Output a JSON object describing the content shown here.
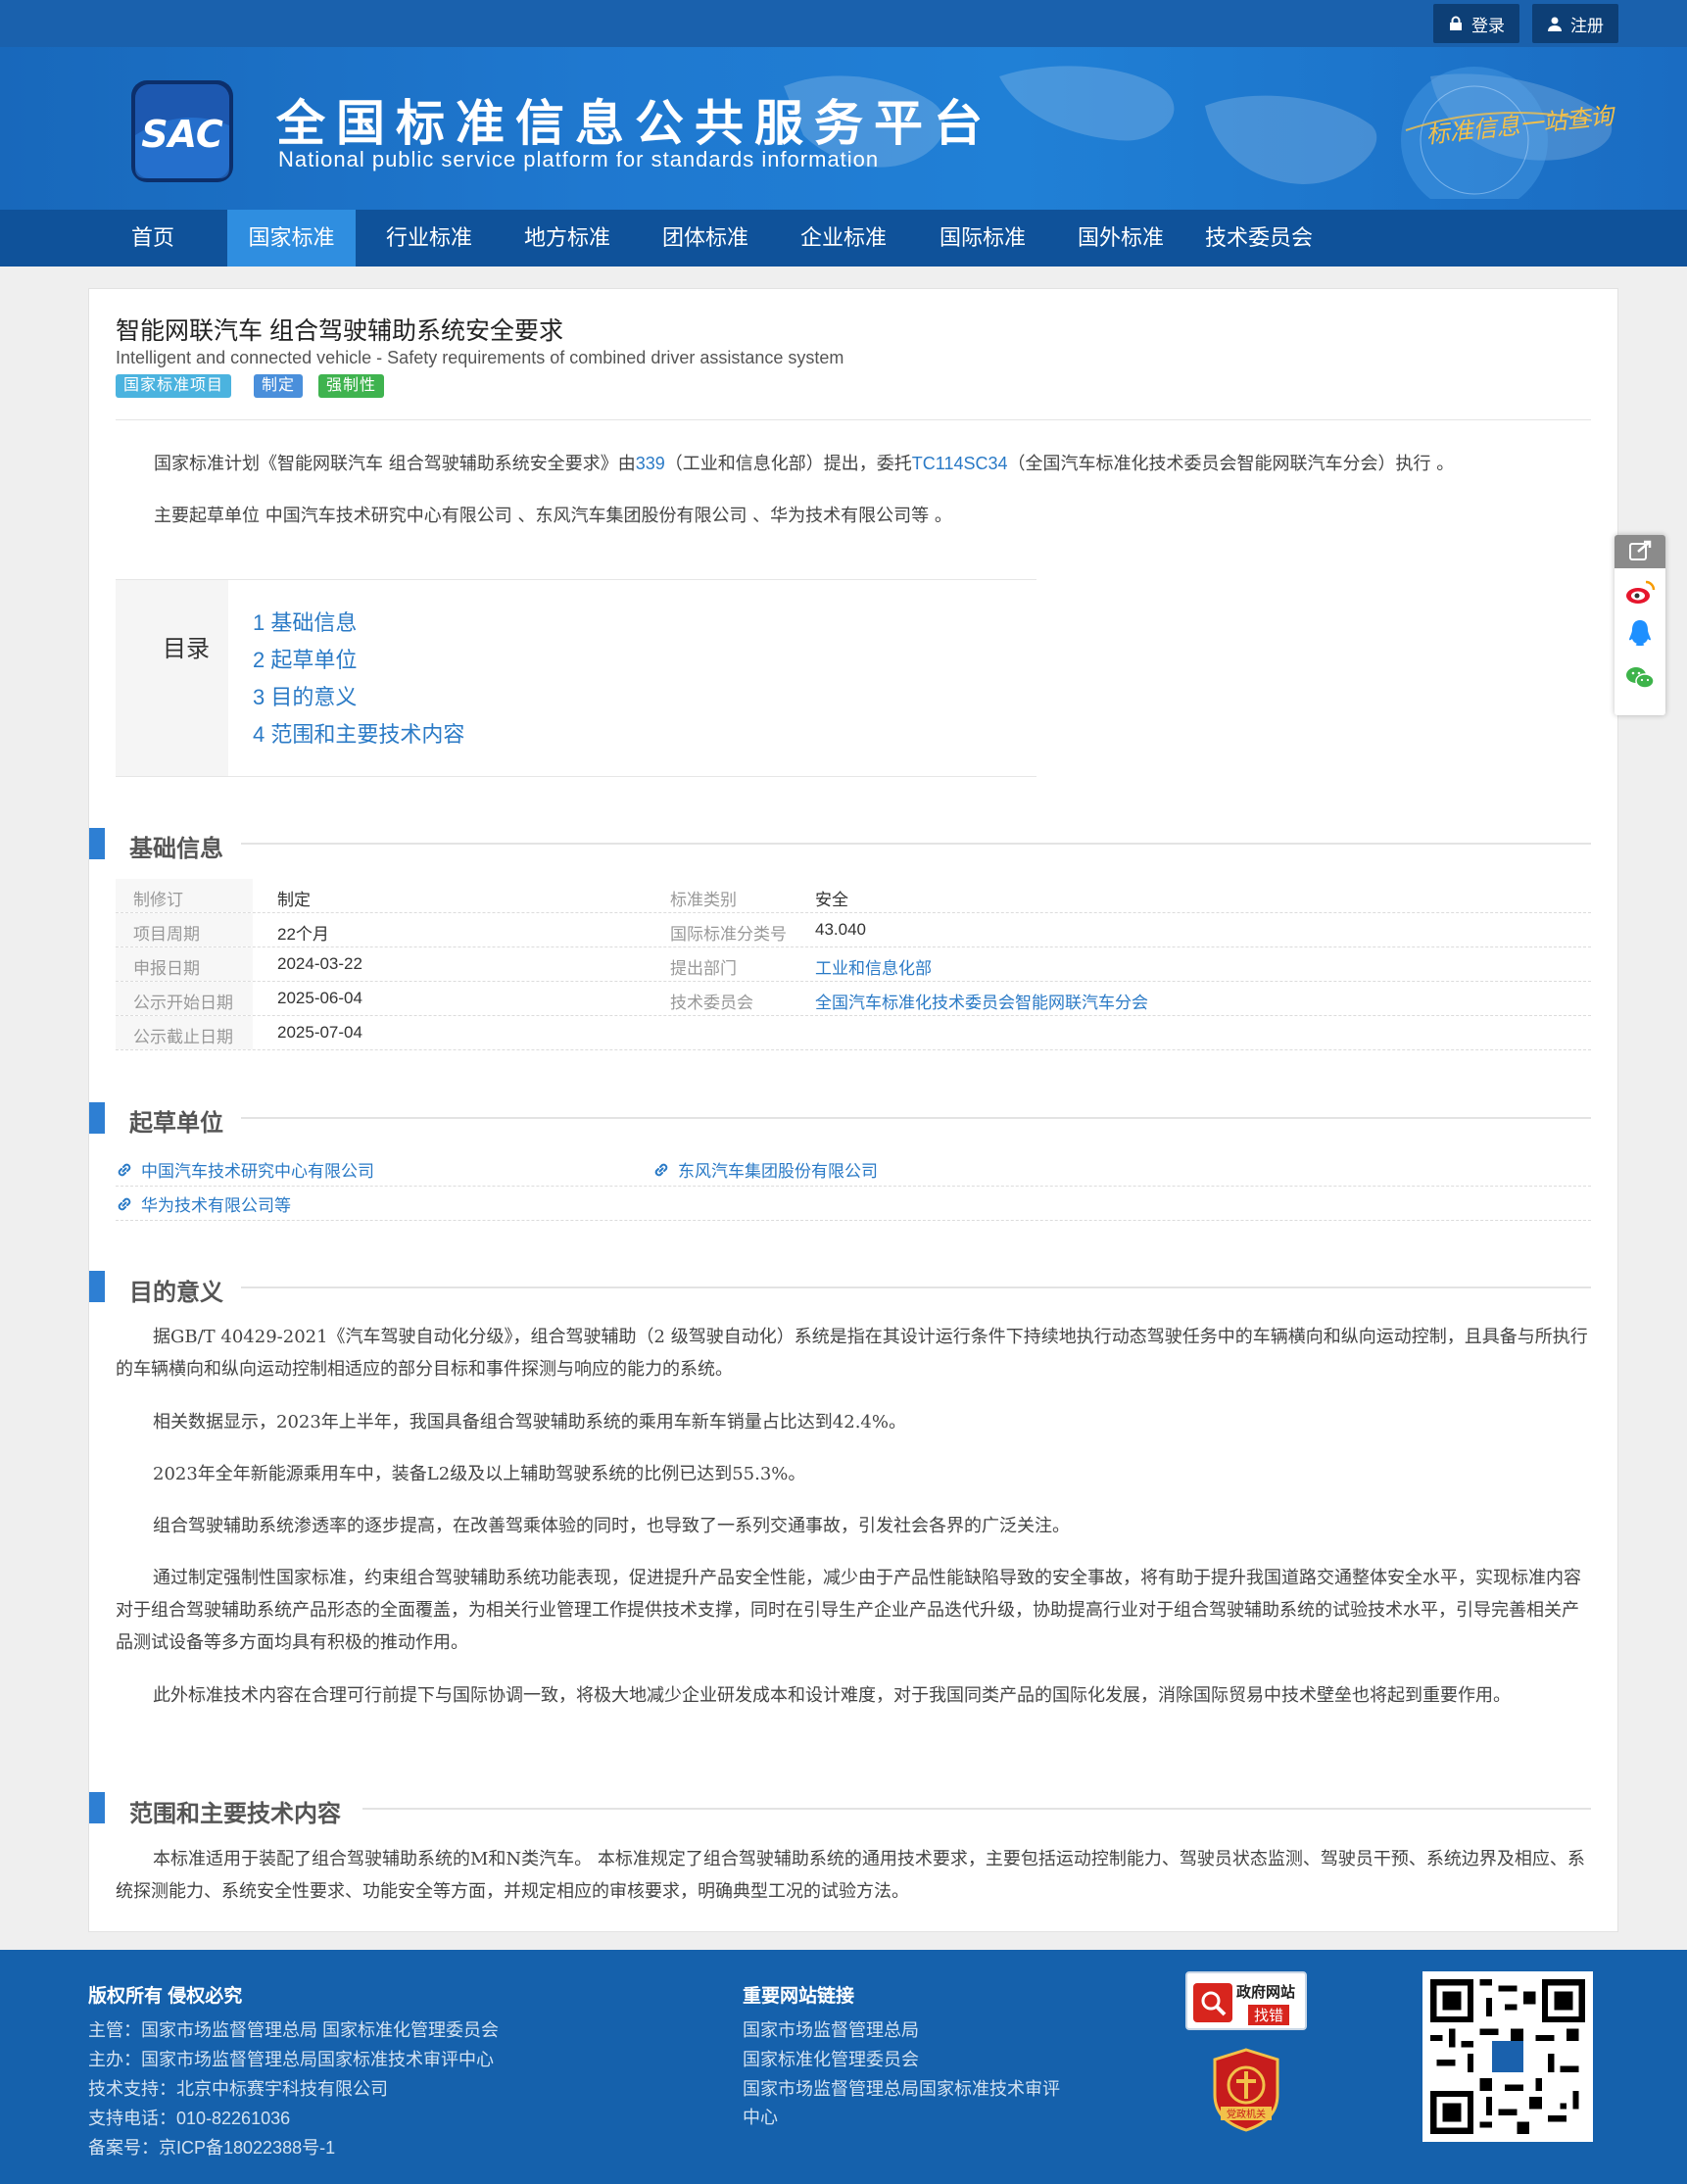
{
  "topbar": {
    "login": "登录",
    "register": "注册"
  },
  "brand": {
    "logo_text": "SAC",
    "name_cn": "全国标准信息公共服务平台",
    "name_en": "National public service platform  for standards information",
    "slogan": "标准信息一站查询"
  },
  "nav": [
    "首页",
    "国家标准",
    "行业标准",
    "地方标准",
    "团体标准",
    "企业标准",
    "国际标准",
    "国外标准",
    "技术委员会"
  ],
  "nav_active": "国家标准",
  "project": {
    "title_cn": "智能网联汽车 组合驾驶辅助系统安全要求",
    "title_en": "Intelligent and connected vehicle - Safety requirements of combined driver assistance system",
    "tags": [
      "国家标准项目",
      "制定",
      "强制性"
    ],
    "intro_1a": "国家标准计划《智能网联汽车 组合驾驶辅助系统安全要求》由",
    "intro_1_link1": "339",
    "intro_1b": "（工业和信息化部）提出，委托",
    "intro_1_link2": "TC114SC34",
    "intro_1c": "（全国汽车标准化技术委员会智能网联汽车分会）执行 。",
    "intro_2": "主要起草单位 中国汽车技术研究中心有限公司 、东风汽车集团股份有限公司 、华为技术有限公司等 。"
  },
  "toc": {
    "label": "目录",
    "items": [
      "1  基础信息",
      "2  起草单位",
      "3  目的意义",
      "4  范围和主要技术内容"
    ]
  },
  "sections": {
    "basic": "基础信息",
    "drafters": "起草单位",
    "purpose": "目的意义",
    "scope": "范围和主要技术内容"
  },
  "basic_info": {
    "left": [
      {
        "label": "制修订",
        "value": "制定"
      },
      {
        "label": "项目周期",
        "value": "22个月"
      },
      {
        "label": "申报日期",
        "value": "2024-03-22"
      },
      {
        "label": "公示开始日期",
        "value": "2025-06-04"
      },
      {
        "label": "公示截止日期",
        "value": "2025-07-04"
      }
    ],
    "right": [
      {
        "label": "标准类别",
        "value": "安全"
      },
      {
        "label": "国际标准分类号",
        "value": "43.040"
      },
      {
        "label": "提出部门",
        "value": "工业和信息化部"
      },
      {
        "label": "技术委员会",
        "value": "全国汽车标准化技术委员会智能网联汽车分会"
      }
    ]
  },
  "drafters": [
    "中国汽车技术研究中心有限公司",
    "东风汽车集团股份有限公司",
    "华为技术有限公司等"
  ],
  "purpose": [
    "据GB/T 40429-2021《汽车驾驶自动化分级》，组合驾驶辅助（2 级驾驶自动化）系统是指在其设计运行条件下持续地执行动态驾驶任务中的车辆横向和纵向运动控制，且具备与所执行的车辆横向和纵向运动控制相适应的部分目标和事件探测与响应的能力的系统。",
    "相关数据显示，2023年上半年，我国具备组合驾驶辅助系统的乘用车新车销量占比达到42.4%。",
    "2023年全年新能源乘用车中，装备L2级及以上辅助驾驶系统的比例已达到55.3%。",
    "组合驾驶辅助系统渗透率的逐步提高，在改善驾乘体验的同时，也导致了一系列交通事故，引发社会各界的广泛关注。",
    "通过制定强制性国家标准，约束组合驾驶辅助系统功能表现，促进提升产品安全性能，减少由于产品性能缺陷导致的安全事故，将有助于提升我国道路交通整体安全水平，实现标准内容对于组合驾驶辅助系统产品形态的全面覆盖，为相关行业管理工作提供技术支撑，同时在引导生产企业产品迭代升级，协助提高行业对于组合驾驶辅助系统的试验技术水平，引导完善相关产品测试设备等多方面均具有积极的推动作用。",
    "此外标准技术内容在合理可行前提下与国际协调一致，将极大地减少企业研发成本和设计难度，对于我国同类产品的国际化发展，消除国际贸易中技术壁垒也将起到重要作用。"
  ],
  "scope": "本标准适用于装配了组合驾驶辅助系统的M和N类汽车。 本标准规定了组合驾驶辅助系统的通用技术要求，主要包括运动控制能力、驾驶员状态监测、驾驶员干预、系统边界及相应、系统探测能力、系统安全性要求、功能安全等方面，并规定相应的审核要求，明确典型工况的试验方法。",
  "footer": {
    "copyright_title": "版权所有 侵权必究",
    "copyright_lines": [
      "主管：国家市场监督管理总局 国家标准化管理委员会",
      "主办：国家市场监督管理总局国家标准技术审评中心",
      "技术支持：北京中标赛宇科技有限公司",
      "支持电话：010-82261036",
      "备案号：京ICP备18022388号-1"
    ],
    "links_title": "重要网站链接",
    "links": [
      "国家市场监督管理总局",
      "国家标准化管理委员会",
      "国家市场监督管理总局国家标准技术审评",
      "中心"
    ],
    "gov_badge_line1": "政府网站",
    "gov_badge_line2": "找错",
    "party_badge": "党政机关"
  },
  "colors": {
    "primary": "#1a61ad",
    "nav": "#0f529a",
    "nav_active": "#2f8ee0",
    "link": "#2a7ac6",
    "section_bar": "#2e7fd3"
  }
}
